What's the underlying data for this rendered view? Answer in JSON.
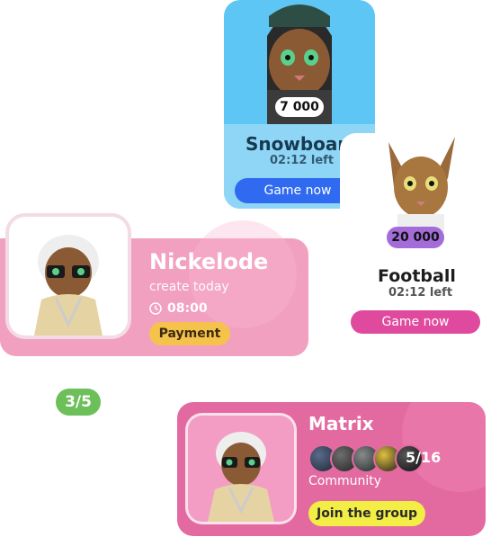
{
  "cards": {
    "snowboard": {
      "price": "7 000",
      "title": "Snowboar",
      "time_left": "02:12 left",
      "button_label": "Game now"
    },
    "football": {
      "price": "20 000",
      "title": "Football",
      "time_left": "02:12 left",
      "button_label": "Game now"
    },
    "nickelode": {
      "title": "Nickelode",
      "subtitle": "create today",
      "time": "08:00",
      "button_label": "Payment"
    },
    "matrix": {
      "title": "Matrix",
      "members_count": "5/16",
      "category": "Community",
      "button_label": "Join the group",
      "member_avatars": 5
    }
  },
  "pager": {
    "label": "3/5"
  },
  "colors": {
    "snowboard_bg": "#5ec6f5",
    "snowboard_button": "#2f6af1",
    "football_button": "#e04a9e",
    "football_price_badge": "#a36cd9",
    "nickelode_bg": "#f1a0bf",
    "payment_button": "#f5c34b",
    "pager_bg": "#6dbf5a",
    "matrix_bg": "#e36aa0",
    "join_button": "#f3ee45"
  }
}
